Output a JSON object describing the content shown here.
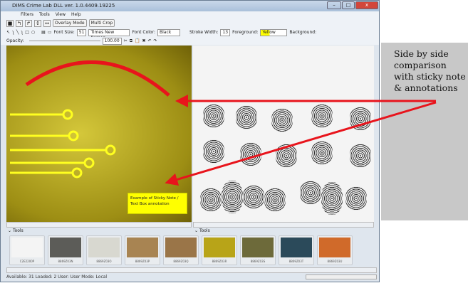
{
  "window": {
    "title": "DIMS Crime Lab DLL ver. 1.0.4409.19225",
    "min": "–",
    "max": "□",
    "close": "x"
  },
  "menu": [
    "Filters",
    "Tools",
    "View",
    "Help"
  ],
  "toolbar": {
    "overlay_mode": "Overlay Mode",
    "multi_crop": "Multi Crop",
    "font_size_label": "Font Size:",
    "font_size": "51",
    "font_name": "Times New Roman",
    "font_color_label": "Font Color:",
    "font_color": "Black",
    "stroke_width_label": "Stroke Width:",
    "stroke_width": "13",
    "foreground_label": "Foreground:",
    "foreground": "Yellow",
    "background_label": "Background:",
    "opacity_label": "Opacity:",
    "opacity": "100.00"
  },
  "sticky_note": "Example of Sticky Note / Text Box annotation",
  "tools_left": "Tools",
  "tools_right": "Tools",
  "thumbnails": [
    {
      "label": "C2E2200P",
      "color": "#f4f4f4"
    },
    {
      "label": "8869Z03N",
      "color": "#5c5c58"
    },
    {
      "label": "8869Z03O",
      "color": "#d8d8d0"
    },
    {
      "label": "8869Z03P",
      "color": "#a88452"
    },
    {
      "label": "8869Z03Q",
      "color": "#9a7548"
    },
    {
      "label": "8869Z03R",
      "color": "#b8a418"
    },
    {
      "label": "8869Z03S",
      "color": "#6d6a3a"
    },
    {
      "label": "8869Z03T",
      "color": "#2b4a5a"
    },
    {
      "label": "8869Z03U",
      "color": "#d06a2a"
    }
  ],
  "status": "Available: 31  Loaded: 2  User: User  Mode: Local",
  "callout": "Side by side comparison with sticky note & annotations",
  "colors": {
    "annotation_red": "#e8141c",
    "annotation_yellow": "#ffff20"
  }
}
